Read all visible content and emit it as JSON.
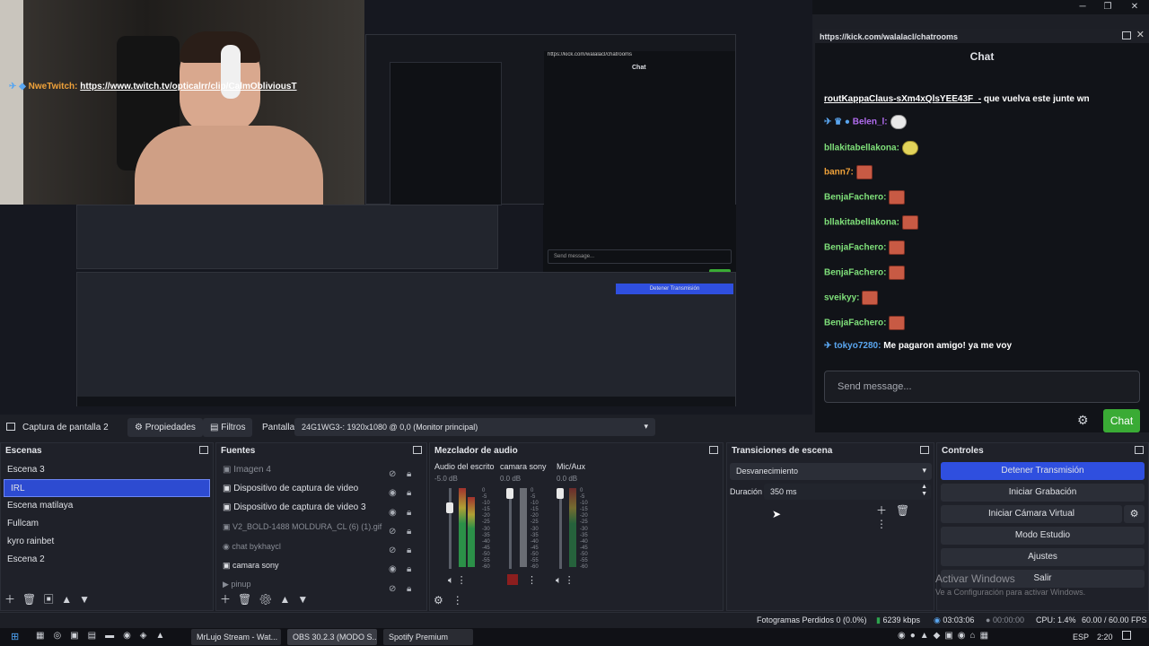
{
  "window": {
    "btn_min": "─",
    "btn_max": "❐",
    "btn_close": "✕"
  },
  "chat": {
    "url": "https://kick.com/walalacl/chatrooms",
    "title": "Chat",
    "messages": [
      {
        "user": "NweTwitch:",
        "user_color": "#f0a23a",
        "text": "https://www.twitch.tv/opticalrr/clip/CalmObliviousT",
        "text2": "routKappaClaus-sXm4xQlsYEE43F_-",
        "text3": " que vuelva este junte wn"
      },
      {
        "user": "Belen_l:",
        "user_color": "#b26cf0",
        "text": ""
      },
      {
        "user": "bllakitabellakona:",
        "user_color": "#7fe07a",
        "text": ""
      },
      {
        "user": "bann7:",
        "user_color": "#f0a23a",
        "text": ""
      },
      {
        "user": "BenjaFachero:",
        "user_color": "#7fe07a",
        "text": ""
      },
      {
        "user": "bllakitabellakona:",
        "user_color": "#7fe07a",
        "text": ""
      },
      {
        "user": "BenjaFachero:",
        "user_color": "#7fe07a",
        "text": ""
      },
      {
        "user": "BenjaFachero:",
        "user_color": "#7fe07a",
        "text": ""
      },
      {
        "user": "sveikyy:",
        "user_color": "#7fe07a",
        "text": ""
      },
      {
        "user": "BenjaFachero:",
        "user_color": "#7fe07a",
        "text": ""
      },
      {
        "user": "tokyo7280:",
        "user_color": "#5aa6f0",
        "text": " Me pagaron amigo! ya me voy"
      }
    ],
    "send_placeholder": "Send message...",
    "send_button": "Chat"
  },
  "toolbar": {
    "source_name": "Captura de pantalla 2",
    "properties": "Propiedades",
    "filters": "Filtros",
    "screen_label": "Pantalla",
    "screen_value": "24G1WG3-: 1920x1080 @ 0,0 (Monitor principal)"
  },
  "scenes": {
    "title": "Escenas",
    "items": [
      "Escena 3",
      "IRL",
      "Escena matilaya",
      "Fullcam",
      "kyro rainbet",
      "Escena 2"
    ]
  },
  "sources": {
    "title": "Fuentes",
    "items": [
      "Imagen 4",
      "Dispositivo de captura de video",
      "Dispositivo de captura de video 3",
      "V2_BOLD-1488 MOLDURA_CL (6) (1).gif",
      "chat bykhaycl",
      "camara sony",
      "pinup"
    ]
  },
  "mixer": {
    "title": "Mezclador de audio",
    "channels": [
      {
        "name": "Audio del escrito",
        "db": "-5.0 dB"
      },
      {
        "name": "camara sony",
        "db": "0.0 dB"
      },
      {
        "name": "Mic/Aux",
        "db": "0.0 dB"
      }
    ],
    "scale": [
      "0",
      "-5",
      "-10",
      "-15",
      "-20",
      "-25",
      "-30",
      "-35",
      "-40",
      "-45",
      "-50",
      "-55",
      "-60"
    ]
  },
  "transitions": {
    "title": "Transiciones de escena",
    "type": "Desvanecimiento",
    "duration_label": "Duración",
    "duration_value": "350 ms"
  },
  "controls": {
    "title": "Controles",
    "stop_stream": "Detener Transmisión",
    "start_recording": "Iniciar Grabación",
    "start_vcam": "Iniciar Cámara Virtual",
    "studio_mode": "Modo Estudio",
    "settings": "Ajustes",
    "exit": "Salir"
  },
  "watermark": {
    "line1": "Activar Windows",
    "line2": "Ve a Configuración para activar Windows."
  },
  "status": {
    "dropped": "Fotogramas Perdidos 0 (0.0%)",
    "bitrate": "6239 kbps",
    "stream_time": "03:03:06",
    "rec_time": "00:00:00",
    "cpu": "CPU: 1.4%",
    "fps": "60.00 / 60.00 FPS"
  },
  "taskbar": {
    "apps": [
      "MrLujo Stream - Wat...",
      "OBS 30.2.3 (MODO S...",
      "Spotify Premium"
    ],
    "lang": "ESP",
    "clock": "2:20"
  },
  "colors": {
    "accent": "#2f4fdf",
    "chat_button": "#3aab35",
    "panel": "#1f2129"
  }
}
